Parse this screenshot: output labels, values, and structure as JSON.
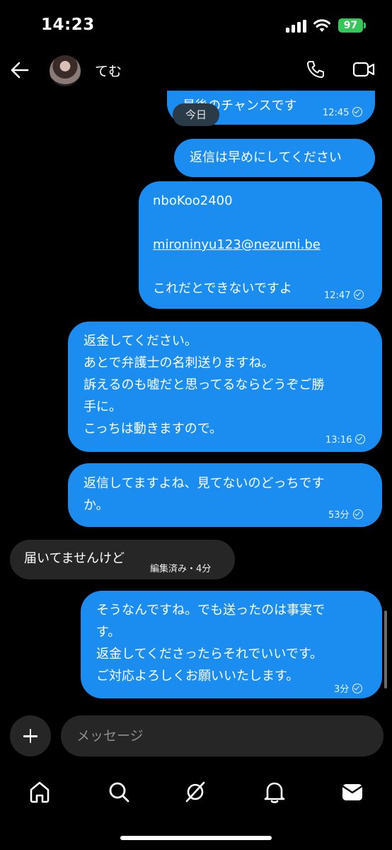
{
  "status_bar": {
    "time": "14:23",
    "battery": "97",
    "battery_color": "#34c759",
    "icons": [
      "signal-icon",
      "wifi-icon",
      "battery-icon"
    ]
  },
  "header": {
    "contact_name": "てむ",
    "icons": [
      "back-arrow-icon",
      "phone-icon",
      "video-camera-icon"
    ]
  },
  "date_divider": "今日",
  "colors": {
    "outgoing_bubble": "#1b8cf0",
    "incoming_bubble": "#262626",
    "background": "#000000"
  },
  "messages": [
    {
      "direction": "out",
      "lines": [
        "最後のチャンスです"
      ],
      "time": "12:45"
    },
    {
      "direction": "out",
      "lines": [
        "返信は早めにしてください"
      ]
    },
    {
      "direction": "out",
      "lines": [
        "nboKoo2400",
        "mironinyu123@nezumi.be",
        "これだとできないですよ"
      ],
      "time": "12:47"
    },
    {
      "direction": "out",
      "lines": [
        "返金してください。",
        "あとで弁護士の名刺送りますね。",
        "訴えるのも嘘だと思ってるならどうぞご勝",
        "手に。",
        "こっちは動きますので。"
      ],
      "time": "13:16"
    },
    {
      "direction": "out",
      "lines": [
        "返信してますよね、見てないのどっちです",
        "か。"
      ],
      "time": "53分"
    },
    {
      "direction": "in",
      "lines": [
        "届いてませんけど"
      ],
      "meta": "編集済み・4分"
    },
    {
      "direction": "out",
      "lines": [
        "そうなんですね。でも送ったのは事実で",
        "す。",
        "返金してくださったらそれでいいです。",
        "ご対応よろしくお願いいたします。"
      ],
      "time": "3分"
    }
  ],
  "composer": {
    "placeholder": "メッセージ",
    "icons": [
      "plus-icon"
    ]
  },
  "bottom_nav": {
    "items": [
      "home-icon",
      "search-icon",
      "explore-icon",
      "notifications-icon",
      "messages-icon"
    ]
  }
}
